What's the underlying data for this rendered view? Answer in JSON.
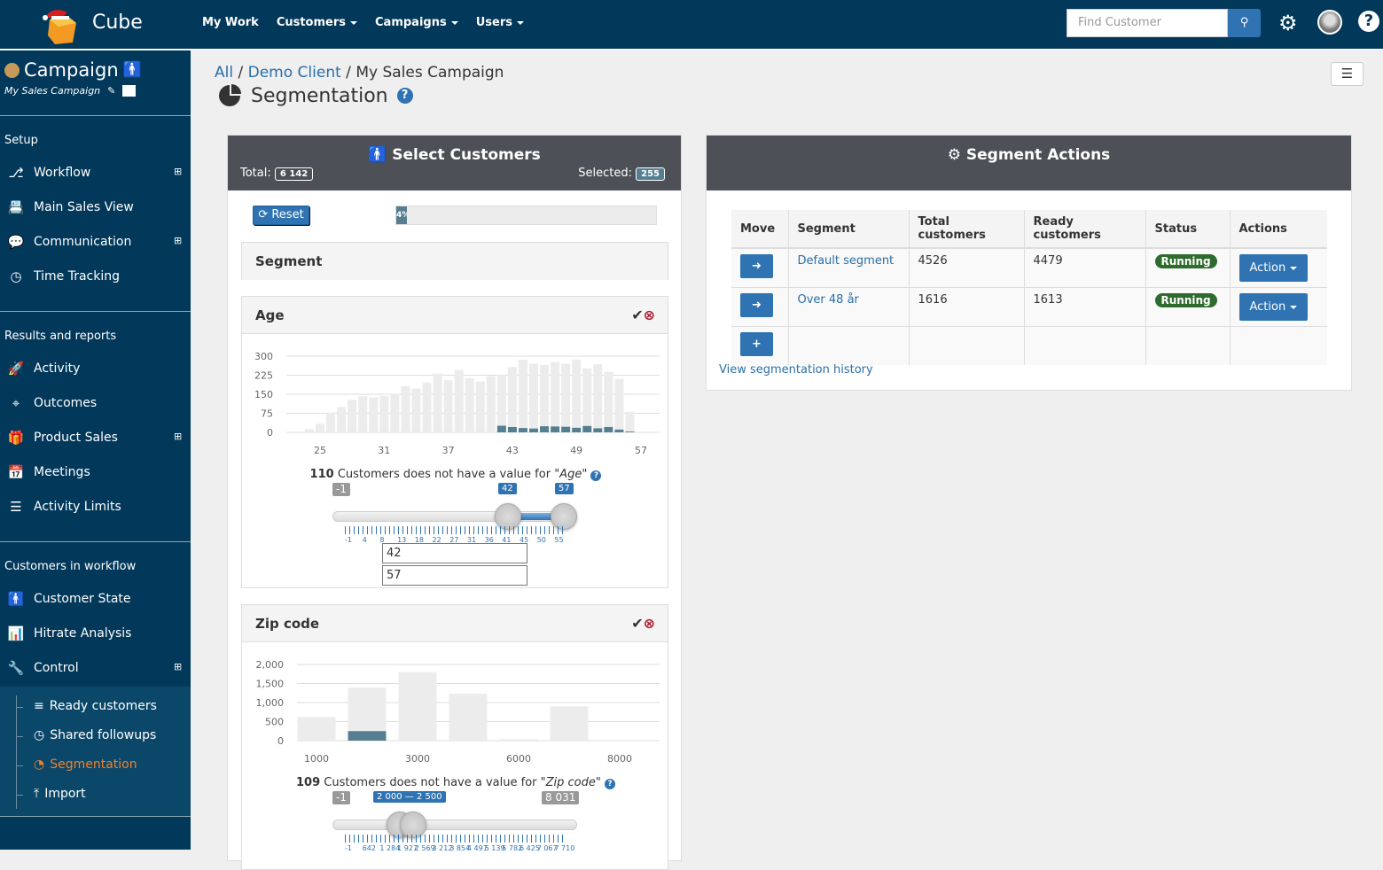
{
  "app": {
    "brand": "Cube",
    "nav": [
      "My Work",
      "Customers",
      "Campaigns",
      "Users"
    ],
    "search_placeholder": "Find Customer"
  },
  "sidebar": {
    "campaign_title": "Campaign",
    "campaign_name": "My Sales Campaign",
    "sections": [
      "Setup",
      "Results and reports",
      "Customers in workflow"
    ],
    "setup": [
      {
        "label": "Workflow",
        "icon": "flow-icon",
        "expand": true
      },
      {
        "label": "Main Sales View",
        "icon": "card-icon"
      },
      {
        "label": "Communication",
        "icon": "chat-icon",
        "expand": true
      },
      {
        "label": "Time Tracking",
        "icon": "clock-icon"
      }
    ],
    "results": [
      {
        "label": "Activity",
        "icon": "rocket-icon"
      },
      {
        "label": "Outcomes",
        "icon": "crosshair-icon"
      },
      {
        "label": "Product Sales",
        "icon": "gift-icon",
        "expand": true
      },
      {
        "label": "Meetings",
        "icon": "calendar-icon"
      },
      {
        "label": "Activity Limits",
        "icon": "sliders-icon"
      }
    ],
    "workflow": [
      {
        "label": "Customer State",
        "icon": "person-icon"
      },
      {
        "label": "Hitrate Analysis",
        "icon": "bar-chart-icon"
      },
      {
        "label": "Control",
        "icon": "wrench-icon",
        "expand": true
      }
    ],
    "control_sub": [
      {
        "label": "Ready customers",
        "icon": "stack-icon"
      },
      {
        "label": "Shared followups",
        "icon": "clock-icon"
      },
      {
        "label": "Segmentation",
        "icon": "pie-icon",
        "active": true
      },
      {
        "label": "Import",
        "icon": "upload-icon"
      }
    ]
  },
  "breadcrumb": {
    "all": "All",
    "client": "Demo Client",
    "campaign": "My Sales Campaign"
  },
  "page_title": "Segmentation",
  "select_customers": {
    "title": "Select Customers",
    "total_label": "Total:",
    "total": "6 142",
    "selected_label": "Selected:",
    "selected": "255",
    "reset_label": "Reset",
    "progress_percent": 4,
    "progress_label": "4%",
    "segment_label": "Segment"
  },
  "colors": {
    "topbar": "#02385a",
    "accent": "#2f73b3",
    "selected_bar": "#557f91",
    "active_menu": "#f0812a",
    "running": "#2e6b2e"
  },
  "chart_data": [
    {
      "type": "bar",
      "title": "Age",
      "stacked": true,
      "x": [
        23,
        24,
        25,
        26,
        27,
        28,
        29,
        30,
        31,
        32,
        33,
        34,
        35,
        36,
        37,
        38,
        39,
        40,
        41,
        42,
        43,
        44,
        45,
        46,
        47,
        48,
        49,
        50,
        51,
        52,
        53,
        54
      ],
      "series": [
        {
          "values": [
            3,
            13,
            33,
            78,
            99,
            128,
            142,
            138,
            144,
            151,
            182,
            173,
            196,
            231,
            205,
            246,
            213,
            200,
            221,
            226,
            257,
            286,
            270,
            265,
            277,
            270,
            286,
            252,
            268,
            238,
            210,
            81
          ]
        },
        {
          "values": [
            0,
            0,
            0,
            0,
            0,
            0,
            0,
            0,
            0,
            0,
            0,
            0,
            0,
            0,
            0,
            0,
            0,
            0,
            0,
            26,
            21,
            17,
            15,
            24,
            23,
            22,
            18,
            25,
            16,
            21,
            11,
            3
          ]
        }
      ],
      "x_ticks": [
        25,
        31,
        37,
        43,
        49,
        57
      ],
      "y_ticks": [
        "0",
        "75",
        "150",
        "225",
        "300"
      ],
      "ylim": [
        0,
        300
      ],
      "grid": true,
      "missing_count": "110",
      "missing_text": "Customers does not have a value for",
      "field": "\"Age\"",
      "slider": {
        "min_label": "-1",
        "low": "42",
        "high": "57",
        "scale": [
          "-1",
          "4",
          "8",
          "13",
          "18",
          "22",
          "27",
          "31",
          "36",
          "41",
          "45",
          "50",
          "55"
        ],
        "input_low": "42",
        "input_high": "57"
      }
    },
    {
      "type": "bar",
      "title": "Zip code",
      "stacked": true,
      "categories": [
        "1000",
        "",
        "3000",
        "",
        "6000",
        "",
        "8000"
      ],
      "series": [
        {
          "values": [
            620,
            1390,
            1800,
            1230,
            40,
            900,
            20
          ]
        },
        {
          "values": [
            0,
            250,
            0,
            0,
            0,
            0,
            0
          ]
        }
      ],
      "y_ticks": [
        "0",
        "500",
        "1,000",
        "1,500",
        "2,000"
      ],
      "ylim": [
        0,
        2000
      ],
      "grid": true,
      "missing_count": "109",
      "missing_text": "Customers does not have a value for",
      "field": "\"Zip code\"",
      "slider": {
        "min_label": "-1",
        "range": "2 000 — 2 500",
        "max_label": "8 031",
        "scale": [
          "-1",
          "642",
          "1 284",
          "1 927",
          "2 569",
          "3 212",
          "3 854",
          "4 497",
          "5 139",
          "5 782",
          "6 425",
          "7 067",
          "7 710"
        ]
      }
    }
  ],
  "segment_actions": {
    "title": "Segment Actions",
    "columns": [
      "Move",
      "Segment",
      "Total customers",
      "Ready customers",
      "Status",
      "Actions"
    ],
    "rows": [
      {
        "segment": "Default segment",
        "total": "4526",
        "ready": "4479",
        "status": "Running",
        "action": "Action"
      },
      {
        "segment": "Over 48 år",
        "total": "1616",
        "ready": "1613",
        "status": "Running",
        "action": "Action"
      }
    ],
    "history_link": "View segmentation history"
  }
}
